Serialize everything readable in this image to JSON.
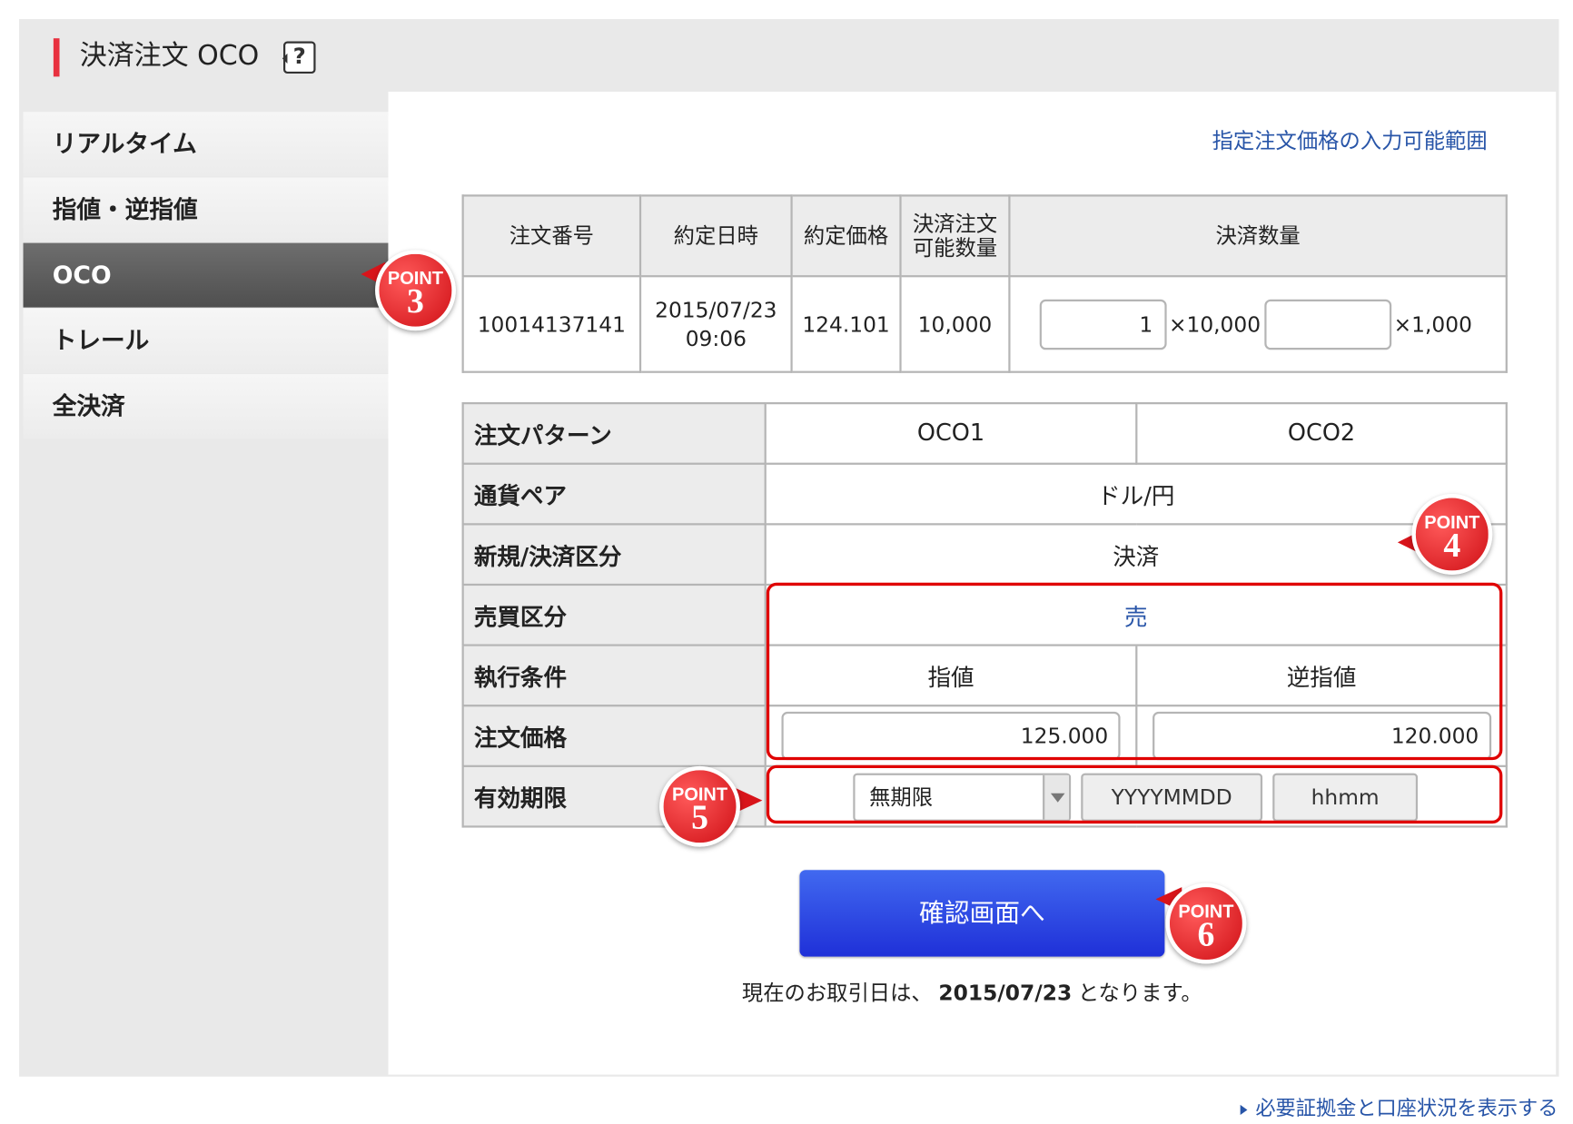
{
  "header": {
    "title": "決済注文 OCO",
    "help_label": "?"
  },
  "sidebar": {
    "items": [
      {
        "label": "リアルタイム",
        "active": false
      },
      {
        "label": "指値・逆指値",
        "active": false
      },
      {
        "label": "OCO",
        "active": true
      },
      {
        "label": "トレール",
        "active": false
      },
      {
        "label": "全決済",
        "active": false
      }
    ]
  },
  "range_link": "指定注文価格の入力可能範囲",
  "position_table": {
    "headers": [
      "注文番号",
      "約定日時",
      "約定価格",
      "決済注文可能数量",
      "決済数量"
    ],
    "header_line1": "決済注文",
    "header_line2": "可能数量",
    "row": {
      "order_number": "10014137141",
      "date": "2015/07/23",
      "time": "09:06",
      "price": "124.101",
      "available_qty": "10,000",
      "qty_10000": "1",
      "unit_10000": "×10,000",
      "qty_1000": "",
      "unit_1000": "×1,000"
    }
  },
  "order_table": {
    "pattern_label": "注文パターン",
    "oco1": "OCO1",
    "oco2": "OCO2",
    "pair_label": "通貨ペア",
    "pair_value": "ドル/円",
    "type_label": "新規/決済区分",
    "type_value": "決済",
    "side_label": "売買区分",
    "side_value": "売",
    "exec_label": "執行条件",
    "exec_oco1": "指値",
    "exec_oco2": "逆指値",
    "price_label": "注文価格",
    "price_oco1": "125.000",
    "price_oco2": "120.000",
    "expire_label": "有効期限",
    "expire_select": "無期限",
    "expire_date_placeholder": "YYYYMMDD",
    "expire_time_placeholder": "hhmm"
  },
  "confirm_button": "確認画面へ",
  "trade_date": {
    "prefix": "現在のお取引日は、",
    "date": "2015/07/23",
    "suffix": "となります。"
  },
  "bottom_link": "必要証拠金と口座状況を表示する",
  "points": [
    {
      "label": "POINT",
      "number": "3"
    },
    {
      "label": "POINT",
      "number": "4"
    },
    {
      "label": "POINT",
      "number": "5"
    },
    {
      "label": "POINT",
      "number": "6"
    }
  ],
  "colors": {
    "accent_red": "#e8313f",
    "link_blue": "#2855a8",
    "button_blue": "#2a40e0",
    "highlight_red": "#e00000"
  }
}
